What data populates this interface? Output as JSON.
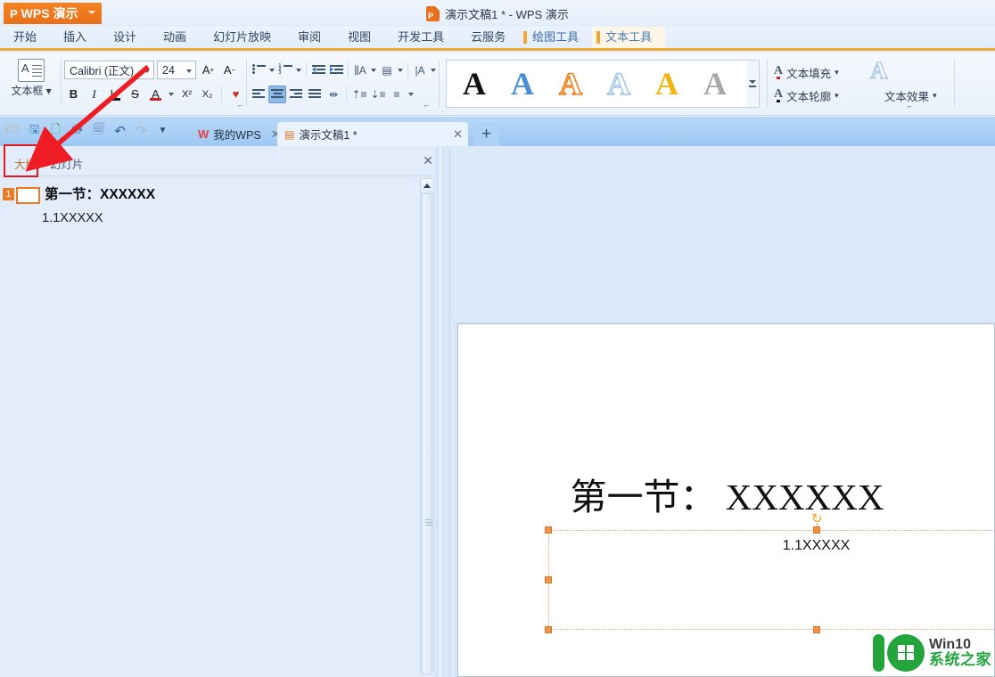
{
  "window": {
    "app_button": "WPS 演示",
    "app_icon": "wps-p-icon",
    "title": "演示文稿1 * - WPS 演示",
    "title_icon": "presentation-doc-icon"
  },
  "ribbon_tabs": [
    {
      "label": "开始",
      "state": "normal"
    },
    {
      "label": "插入",
      "state": "normal"
    },
    {
      "label": "设计",
      "state": "normal"
    },
    {
      "label": "动画",
      "state": "normal"
    },
    {
      "label": "幻灯片放映",
      "state": "normal"
    },
    {
      "label": "审阅",
      "state": "normal"
    },
    {
      "label": "视图",
      "state": "normal"
    },
    {
      "label": "开发工具",
      "state": "normal"
    },
    {
      "label": "云服务",
      "state": "normal"
    },
    {
      "label": "绘图工具",
      "state": "contextual"
    },
    {
      "label": "文本工具",
      "state": "active-contextual"
    }
  ],
  "ribbon": {
    "textbox_group": {
      "label": "文本框",
      "icon": "text-box-icon",
      "dropdown": "▾"
    },
    "font_group": {
      "font_name": "Calibri (正文)",
      "font_size": "24",
      "grow_font": "A",
      "shrink_font": "A",
      "bold": "B",
      "italic": "I",
      "underline": "U",
      "strikethrough": "S",
      "font_color": "A",
      "superscript": "X²",
      "subscript": "X₂",
      "clear_format": "♥"
    },
    "paragraph_group": {
      "bullets": "bullet-list-icon",
      "numbering": "numbered-list-icon",
      "decrease_indent": "decrease-indent-icon",
      "increase_indent": "increase-indent-icon",
      "text_direction": "text-direction-icon",
      "align_text": "align-text-icon",
      "char_spacing": "character-spacing-icon",
      "align_left": "align-left-icon",
      "align_center": "align-center-icon",
      "align_right": "align-right-icon",
      "align_justify": "align-justify-icon",
      "align_distributed": "align-distributed-icon",
      "line_spacing": "line-spacing-icon",
      "para_spacing": "paragraph-spacing-icon",
      "columns": "columns-icon",
      "active_alignment": "align_center"
    },
    "wordart_gallery": {
      "styles": [
        {
          "name": "wordart-black-fill",
          "letter": "A",
          "fill": "#101010",
          "stroke": ""
        },
        {
          "name": "wordart-blue-fill",
          "letter": "A",
          "fill": "#4a90d9",
          "stroke": ""
        },
        {
          "name": "wordart-orange-outline",
          "letter": "A",
          "fill": "#ffffff",
          "stroke": "#ef7f1a"
        },
        {
          "name": "wordart-lightblue-outline",
          "letter": "A",
          "fill": "#ffffff",
          "stroke": "#9ec4e8"
        },
        {
          "name": "wordart-gold-fill",
          "letter": "A",
          "fill": "#f0b40f",
          "stroke": ""
        },
        {
          "name": "wordart-gray-fill",
          "letter": "A",
          "fill": "#a3a9ad",
          "stroke": ""
        }
      ],
      "scroll_more": "more-styles-icon"
    },
    "effects_group": {
      "text_fill": "文本填充",
      "text_outline": "文本轮廓",
      "text_effects": "文本效果",
      "preview_letter": "A"
    }
  },
  "quick_access": {
    "items": [
      {
        "name": "open-icon",
        "glyph": "📂"
      },
      {
        "name": "save-icon",
        "glyph": "💾"
      },
      {
        "name": "save-as-icon",
        "glyph": "🖫"
      },
      {
        "name": "print-icon",
        "glyph": "🖨"
      },
      {
        "name": "print-preview-icon",
        "glyph": "🗋"
      },
      {
        "name": "undo-icon",
        "glyph": "↶"
      },
      {
        "name": "redo-icon",
        "glyph": "↷"
      },
      {
        "name": "customize-icon",
        "glyph": "▾"
      }
    ]
  },
  "doc_tabs": [
    {
      "label": "我的WPS",
      "icon": "wps-home-icon",
      "active": false,
      "close": "✕"
    },
    {
      "label": "演示文稿1 *",
      "icon": "presentation-file-icon",
      "active": true,
      "close": "✕"
    }
  ],
  "new_tab_button": "+",
  "outline_pane": {
    "tabs": [
      {
        "label": "大纲",
        "active": true
      },
      {
        "label": "幻灯片",
        "active": false
      }
    ],
    "close": "✕",
    "slides": [
      {
        "number": "1",
        "title": "第一节：XXXXXX",
        "body": "1.1XXXXX"
      }
    ]
  },
  "slide": {
    "title": "第一节： XXXXXX",
    "subtitle": "1.1XXXXX",
    "selected_placeholder": "subtitle-textbox",
    "rotation_handle": "rotate-handle-icon"
  },
  "annotation": {
    "arrow_color": "#ee1c23",
    "highlight_target": "大纲",
    "highlight_color": "#e8191b"
  },
  "watermark": {
    "line1": "Win10",
    "line2": "系统之家",
    "logo": "win10-home-logo",
    "green": "#23a53c"
  }
}
